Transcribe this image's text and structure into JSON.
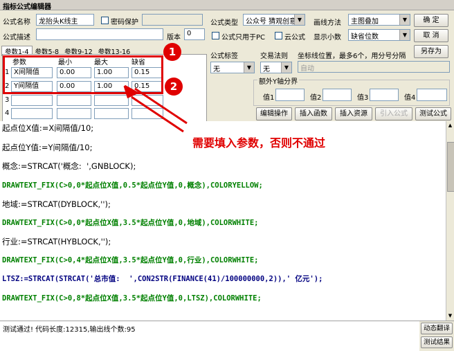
{
  "window": {
    "title": "指标公式编辑器"
  },
  "form": {
    "name_label": "公式名称",
    "name_value": "龙抬头K线主",
    "password_label": "密码保护",
    "desc_label": "公式描述",
    "version_label": "版本",
    "version_value": "0",
    "type_label": "公式类型",
    "type_value": "公众号 猜观创意",
    "draw_label": "画线方法",
    "draw_value": "主图叠加",
    "pc_only_label": "公式只用于PC",
    "cloud_label": "云公式",
    "decimals_label": "显示小数",
    "decimals_value": "缺省位数",
    "tag_label": "公式标签",
    "tag_value": "无",
    "trade_label": "交易法则",
    "trade_value": "无",
    "coord_label": "坐标线位置，最多6个，用分号分隔",
    "coord_value": "自动",
    "extra_y_label": "额外Y轴分界",
    "val1": "值1",
    "val2": "值2",
    "val3": "值3",
    "val4": "值4"
  },
  "buttons": {
    "ok": "确 定",
    "cancel": "取 消",
    "save_as": "另存为",
    "edit": "编辑操作",
    "insert_func": "插入函数",
    "insert_res": "插入资源",
    "import": "引入公式",
    "test": "测试公式"
  },
  "param_tabs": [
    "参数1-4",
    "参数5-8",
    "参数9-12",
    "参数13-16"
  ],
  "param_table": {
    "headers": [
      "参数",
      "最小",
      "最大",
      "缺省"
    ],
    "rows": [
      {
        "idx": "1",
        "name": "X间隔值",
        "min": "0.00",
        "max": "1.00",
        "def": "0.15"
      },
      {
        "idx": "2",
        "name": "Y间隔值",
        "min": "0.00",
        "max": "1.00",
        "def": "0.15"
      },
      {
        "idx": "3",
        "name": "",
        "min": "",
        "max": "",
        "def": ""
      },
      {
        "idx": "4",
        "name": "",
        "min": "",
        "max": "",
        "def": ""
      }
    ]
  },
  "annotations": {
    "badge1": "1",
    "badge2": "2",
    "note": "需要填入参数，否则不通过"
  },
  "code_lines": [
    "起点位X值:=X间隔值/10;",
    "起点位Y值:=Y间隔值/10;",
    "概念:=STRCAT('概念:  ',GNBLOCK);",
    "DRAWTEXT_FIX(C>0,0*起点位X值,0.5*起点位Y值,0,概念),COLORYELLOW;",
    "地域:=STRCAT(DYBLOCK,'');",
    "DRAWTEXT_FIX(C>0,0*起点位X值,3.5*起点位Y值,0,地域),COLORWHITE;",
    "行业:=STRCAT(HYBLOCK,'');",
    "DRAWTEXT_FIX(C>0,4*起点位X值,3.5*起点位Y值,0,行业),COLORWHITE;",
    "LTSZ:=STRCAT(STRCAT('总市值:  ',CON2STR(FINANCE(41)/100000000,2)),' 亿元');",
    "DRAWTEXT_FIX(C>0,8*起点位X值,3.5*起点位Y值,0,LTSZ),COLORWHITE;"
  ],
  "status": {
    "message": "测试通过! 代码长度:12315,输出线个数:95",
    "dynamic_translate": "动态翻译",
    "test_result": "测试结果"
  },
  "colors": {
    "annotation_red": "#e00000",
    "code_green": "#008000",
    "code_blue": "#000080"
  }
}
